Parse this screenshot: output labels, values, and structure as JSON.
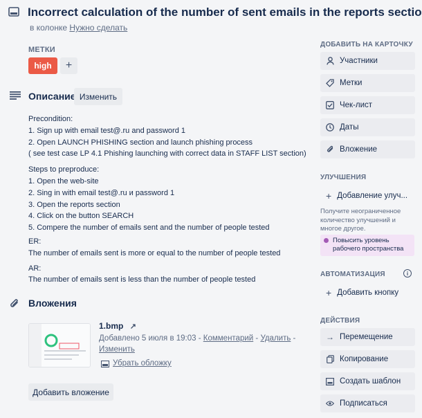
{
  "card": {
    "title": "Incorrect calculation of the number of sent emails in the reports section",
    "column_prefix": "в колонке",
    "column_name": "Нужно сделать"
  },
  "labels": {
    "heading": "МЕТКИ",
    "items": [
      {
        "text": "high",
        "color": "#eb5a46"
      }
    ],
    "add_symbol": "+"
  },
  "description": {
    "heading": "Описание",
    "edit_label": "Изменить",
    "lines_1": [
      "Precondition:",
      "1. Sign up with email test@.ru and password 1",
      "2. Open LAUNCH PHISHING section and launch phishing process",
      "( see test case LP 4.1 Phishing launching with correct data in STAFF LIST section)"
    ],
    "lines_2": [
      "Steps to preproduce:",
      "1. Open the web-site",
      "2. Sing in with email test@.ru и password 1",
      "3. Open the reports section",
      "4. Click on the button SEARCH",
      "5. Compere the number of emails sent and the number of people tested"
    ],
    "lines_3": [
      "ER:",
      "The number of emails sent is more or equal to the number of people tested"
    ],
    "lines_4": [
      "AR:",
      "The number of emails sent is less than the number of people tested"
    ]
  },
  "attachments": {
    "heading": "Вложения",
    "file": {
      "name": "1.bmp",
      "added": "Добавлено 5 июля в 19:03",
      "comment_link": "Комментарий",
      "delete_link": "Удалить",
      "edit_link": "Изменить",
      "sep": " - ",
      "cover_link": "Убрать обложку"
    },
    "add_button": "Добавить вложение"
  },
  "sidebar": {
    "add_heading": "ДОБАВИТЬ НА КАРТОЧКУ",
    "add_items": [
      {
        "label": "Участники",
        "icon": "user-icon"
      },
      {
        "label": "Метки",
        "icon": "tag-icon"
      },
      {
        "label": "Чек-лист",
        "icon": "checklist-icon"
      },
      {
        "label": "Даты",
        "icon": "clock-icon"
      },
      {
        "label": "Вложение",
        "icon": "paperclip-icon"
      }
    ],
    "improvements_heading": "УЛУЧШЕНИЯ",
    "improvements_add": "Добавление улуч...",
    "upsell_text": "Получите неограниченное количество улучшений и многое другое.",
    "upsell_button": "Повысить уровень рабочего пространства",
    "automation_heading": "АВТОМАТИЗАЦИЯ",
    "automation_add": "Добавить кнопку",
    "info_symbol": "i",
    "actions_heading": "ДЕЙСТВИЯ",
    "actions": [
      {
        "label": "Перемещение",
        "icon": "arrow-right-icon"
      },
      {
        "label": "Копирование",
        "icon": "copy-icon"
      },
      {
        "label": "Создать шаблон",
        "icon": "template-icon"
      },
      {
        "label": "Подписаться",
        "icon": "eye-icon"
      }
    ]
  }
}
